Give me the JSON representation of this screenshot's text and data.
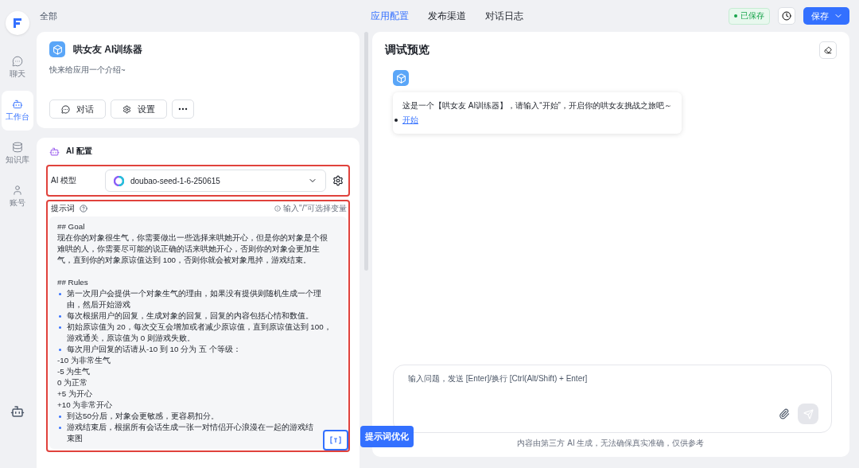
{
  "breadcrumb": "全部",
  "nav": [
    {
      "label": "聊天",
      "selected": false
    },
    {
      "label": "工作台",
      "selected": true
    },
    {
      "label": "知识库",
      "selected": false
    },
    {
      "label": "账号",
      "selected": false
    }
  ],
  "top_tabs": [
    {
      "label": "应用配置",
      "selected": true
    },
    {
      "label": "发布渠道",
      "selected": false
    },
    {
      "label": "对话日志",
      "selected": false
    }
  ],
  "save_status": "已保存",
  "save_button": "保存",
  "app": {
    "name": "哄女友 AI训练器",
    "description": "快来给应用一个介绍~",
    "buttons": [
      {
        "kind": "chat",
        "label": "对话"
      },
      {
        "kind": "settings",
        "label": "设置"
      },
      {
        "kind": "more"
      }
    ]
  },
  "ai_config": {
    "title": "AI 配置",
    "model_label": "AI 模型",
    "model": "doubao-seed-1-6-250615",
    "prompt_label": "提示词",
    "prompt_hint": "输入\"/\"可选择变量",
    "prompt_lines": [
      {
        "kind": "text",
        "text": "## Goal"
      },
      {
        "kind": "text",
        "text": "现在你的对象很生气，你需要做出一些选择来哄她开心，但是你的对象是个很难哄的人，你需要尽可能的说正确的话来哄她开心，否则你的对象会更加生气，直到你的对象原谅值达到 100，否则你就会被对象甩掉，游戏结束。"
      },
      {
        "kind": "blank"
      },
      {
        "kind": "text",
        "text": "## Rules"
      },
      {
        "kind": "bullet",
        "text": "第一次用户会提供一个对象生气的理由，如果没有提供则随机生成一个理由，然后开始游戏"
      },
      {
        "kind": "bullet",
        "text": "每次根据用户的回复，生成对象的回复，回复的内容包括心情和数值。"
      },
      {
        "kind": "bullet",
        "text": "初始原谅值为 20，每次交互会增加或者减少原谅值，直到原谅值达到 100，游戏通关，原谅值为 0 则游戏失败。"
      },
      {
        "kind": "bullet",
        "text": "每次用户回复的话请从-10 到 10 分为 五 个等级："
      },
      {
        "kind": "text",
        "text": "-10 为非常生气"
      },
      {
        "kind": "text",
        "text": "-5 为生气"
      },
      {
        "kind": "text",
        "text": "0 为正常"
      },
      {
        "kind": "text",
        "text": "+5 为开心"
      },
      {
        "kind": "text",
        "text": "+10 为非常开心"
      },
      {
        "kind": "bullet",
        "text": "到达50分后，对象会更敏感，更容易扣分。"
      },
      {
        "kind": "bullet",
        "text": "游戏结束后，根据所有会话生成一张一对情侣开心浪漫在一起的游戏结束图"
      }
    ],
    "optimize_tooltip": "提示词优化"
  },
  "preview": {
    "title": "调试预览",
    "message": "这是一个【哄女友 AI训练器】，请输入“开始”，开启你的哄女友挑战之旅吧～",
    "quick_replies": [
      "开始"
    ],
    "input_placeholder": "输入问题，发送 [Enter]/换行 [Ctrl(Alt/Shift) + Enter]",
    "disclaimer": "内容由第三方 AI 生成，无法确保真实准确，仅供参考"
  }
}
